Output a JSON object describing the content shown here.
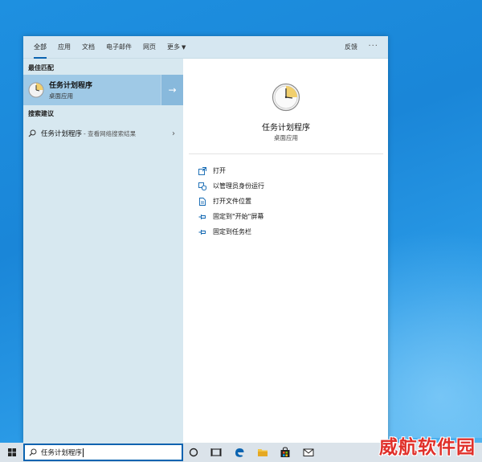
{
  "tabs": [
    {
      "label": "全部",
      "active": true
    },
    {
      "label": "应用"
    },
    {
      "label": "文档"
    },
    {
      "label": "电子邮件"
    },
    {
      "label": "网页"
    },
    {
      "label": "更多"
    }
  ],
  "topbar": {
    "feedback": "反馈",
    "more": "···"
  },
  "left": {
    "best_match_label": "最佳匹配",
    "best_match": {
      "name": "任务计划程序",
      "type": "桌面应用"
    },
    "suggest_label": "搜索建议",
    "suggestion": {
      "name": "任务计划程序",
      "hint": "- 查看网络搜索结果"
    }
  },
  "detail": {
    "title": "任务计划程序",
    "subtitle": "桌面应用",
    "actions": [
      {
        "label": "打开",
        "icon": "open-icon"
      },
      {
        "label": "以管理员身份运行",
        "icon": "shield-icon"
      },
      {
        "label": "打开文件位置",
        "icon": "file-location-icon"
      },
      {
        "label": "固定到\"开始\"屏幕",
        "icon": "pin-icon"
      },
      {
        "label": "固定到任务栏",
        "icon": "pin-icon"
      }
    ]
  },
  "taskbar": {
    "search_value": "任务计划程序"
  },
  "watermark": "威航软件园",
  "colors": {
    "accent": "#0a63b0",
    "selected": "#9fc9e6",
    "left_bg": "#d7e8f0"
  }
}
